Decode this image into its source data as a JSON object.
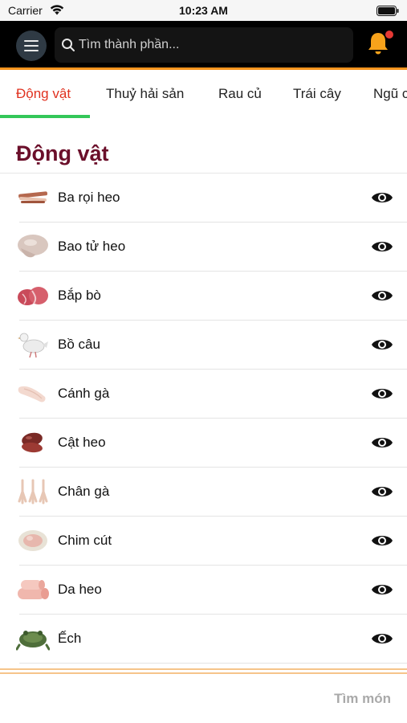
{
  "status_bar": {
    "carrier": "Carrier",
    "time": "10:23 AM"
  },
  "header": {
    "search_placeholder": "Tìm thành phần...",
    "accent_color": "#f7941d",
    "notification_badge_color": "#e53935"
  },
  "tabs": [
    {
      "label": "Động vật",
      "active": true
    },
    {
      "label": "Thuỷ hải sản",
      "active": false
    },
    {
      "label": "Rau củ",
      "active": false
    },
    {
      "label": "Trái cây",
      "active": false
    },
    {
      "label": "Ngũ cốc",
      "active": false
    }
  ],
  "section": {
    "title": "Động vật"
  },
  "items": [
    {
      "label": "Ba rọi heo",
      "icon": "pork-belly-thumbnail"
    },
    {
      "label": "Bao tử heo",
      "icon": "pig-stomach-thumbnail"
    },
    {
      "label": "Bắp bò",
      "icon": "beef-shank-thumbnail"
    },
    {
      "label": "Bồ câu",
      "icon": "pigeon-thumbnail"
    },
    {
      "label": "Cánh gà",
      "icon": "chicken-wing-thumbnail"
    },
    {
      "label": "Cật heo",
      "icon": "pig-kidney-thumbnail"
    },
    {
      "label": "Chân gà",
      "icon": "chicken-feet-thumbnail"
    },
    {
      "label": "Chim cút",
      "icon": "quail-thumbnail"
    },
    {
      "label": "Da heo",
      "icon": "pork-skin-thumbnail"
    },
    {
      "label": "Ếch",
      "icon": "frog-thumbnail"
    }
  ],
  "footer": {
    "action_label": "Tìm món"
  },
  "colors": {
    "active_tab": "#e0311f",
    "tab_underline": "#34c759",
    "section_title": "#6b0f2a"
  }
}
